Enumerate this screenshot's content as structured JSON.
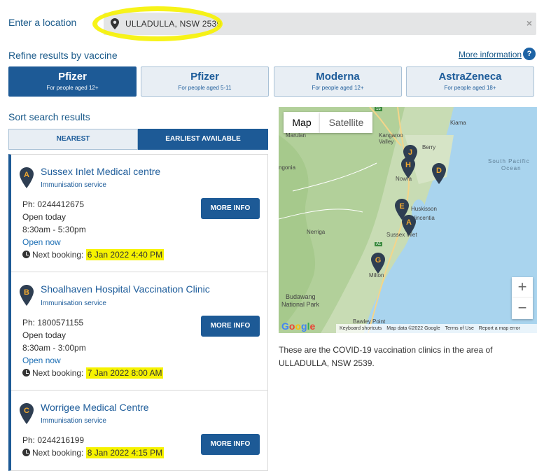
{
  "location": {
    "label": "Enter a location",
    "value": "ULLADULLA, NSW 2539",
    "clear_icon": "×"
  },
  "refine": {
    "label": "Refine results by vaccine",
    "more_info": "More information",
    "help_icon": "?",
    "vaccines": [
      {
        "name": "Pfizer",
        "sub": "For people aged 12+",
        "active": true
      },
      {
        "name": "Pfizer",
        "sub": "For people aged 5-11",
        "active": false
      },
      {
        "name": "Moderna",
        "sub": "For people aged 12+",
        "active": false
      },
      {
        "name": "AstraZeneca",
        "sub": "For people aged 18+",
        "active": false
      }
    ]
  },
  "sort": {
    "label": "Sort search results",
    "options": [
      "NEAREST",
      "EARLIEST AVAILABLE"
    ],
    "active": "EARLIEST AVAILABLE"
  },
  "clinics": [
    {
      "letter": "A",
      "name": "Sussex Inlet Medical centre",
      "type": "Immunisation service",
      "phone": "Ph: 0244412675",
      "open": "Open today",
      "hours": "8:30am - 5:30pm",
      "status": "Open now",
      "booking_label": "Next booking:",
      "booking_value": "6 Jan 2022 4:40 PM",
      "button": "MORE INFO"
    },
    {
      "letter": "B",
      "name": "Shoalhaven Hospital Vaccination Clinic",
      "type": "Immunisation service",
      "phone": "Ph: 1800571155",
      "open": "Open today",
      "hours": "8:30am - 3:00pm",
      "status": "Open now",
      "booking_label": "Next booking:",
      "booking_value": "7 Jan 2022 8:00 AM",
      "button": "MORE INFO"
    },
    {
      "letter": "C",
      "name": "Worrigee Medical Centre",
      "type": "Immunisation service",
      "phone": "Ph: 0244216199",
      "booking_label": "Next booking:",
      "booking_value": "8 Jan 2022 4:15 PM",
      "button": "MORE INFO"
    }
  ],
  "map": {
    "type_options": [
      "Map",
      "Satellite"
    ],
    "zoom_in": "+",
    "zoom_out": "−",
    "logo": "Google",
    "footer": [
      "Keyboard shortcuts",
      "Map data ©2022 Google",
      "Terms of Use",
      "Report a map error"
    ],
    "places": [
      "Marulan",
      "Kangaroo Valley",
      "Berry",
      "Kiama",
      "South Pacific",
      "Ocean",
      "ngonia",
      "Huskisson",
      "Vincentia",
      "Sussex Inlet",
      "Nerriga",
      "Milton",
      "Budawang",
      "National Park",
      "Bawley Point",
      "Nowra",
      "A1",
      "15"
    ],
    "markers": [
      "J",
      "H",
      "D",
      "E",
      "A",
      "G"
    ]
  },
  "caption": "These are the COVID-19 vaccination clinics in the area of ULLADULLA, NSW 2539.",
  "colors": {
    "primary": "#1d5a96",
    "link": "#1a5a8a",
    "highlight": "#f6f200",
    "marker": "#2e3e52",
    "marker_letter": "#f0a830"
  }
}
